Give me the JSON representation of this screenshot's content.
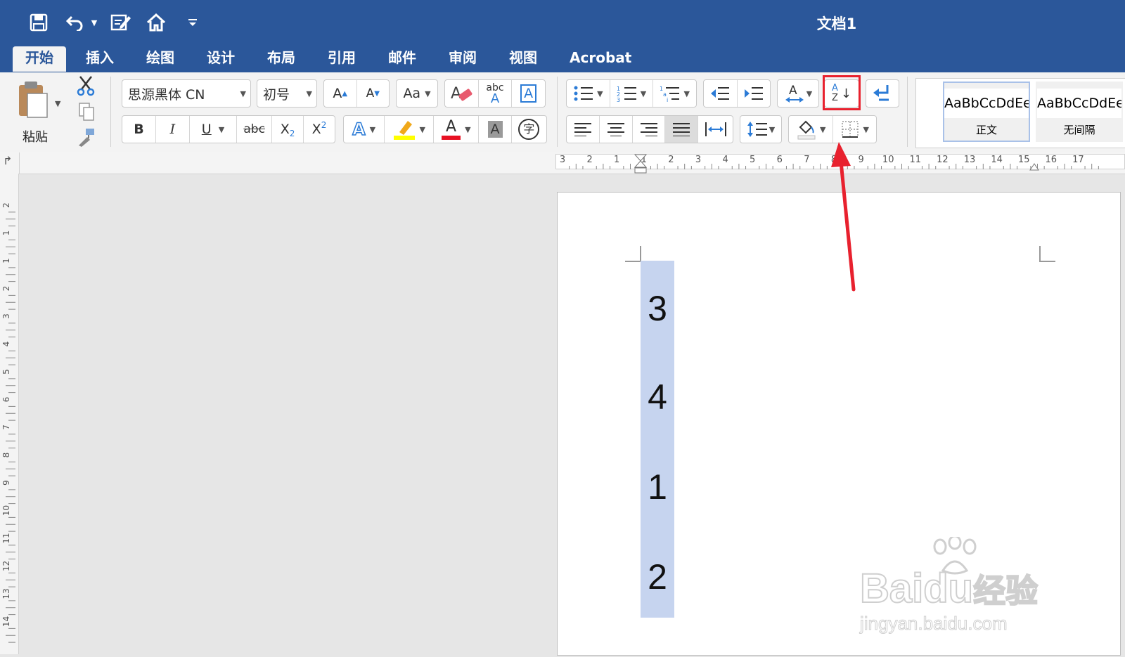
{
  "document": {
    "title": "文档1"
  },
  "quick_access": [
    "save-icon",
    "undo-icon",
    "edit-document-icon",
    "home-icon",
    "customize-icon"
  ],
  "tabs": [
    "开始",
    "插入",
    "绘图",
    "设计",
    "布局",
    "引用",
    "邮件",
    "审阅",
    "视图",
    "Acrobat"
  ],
  "ribbon": {
    "paste_label": "粘贴",
    "font_name": "思源黑体 CN",
    "font_size": "初号",
    "grow_font": "A",
    "shrink_font": "A",
    "change_case": "Aa",
    "phonetic": "abc",
    "char_border": "A",
    "bold": "B",
    "italic": "I",
    "underline": "U",
    "strike": "abc",
    "subscript": "X",
    "subscript_mark": "2",
    "superscript": "X",
    "superscript_mark": "2",
    "text_effect": "A",
    "font_color_label": "A",
    "char_shading": "A",
    "enclose_char": "字",
    "sort_top": "A",
    "sort_bottom": "Z",
    "styles": [
      {
        "preview": "AaBbCcDdEe",
        "name": "正文"
      },
      {
        "preview": "AaBbCcDdEe",
        "name": "无间隔"
      }
    ]
  },
  "colors": {
    "accent": "#2b579a",
    "highlight": "#ffff00",
    "font_color": "#e81123",
    "selection": "#c6d4ef",
    "annotation": "#e8212e"
  },
  "ruler": {
    "h_labels": [
      "3",
      "2",
      "1",
      "1",
      "2",
      "3",
      "4",
      "5",
      "6",
      "7",
      "8",
      "9",
      "10",
      "11",
      "12",
      "13",
      "14",
      "15",
      "16",
      "17"
    ],
    "v_labels": [
      "2",
      "1",
      "1",
      "2",
      "3",
      "4",
      "5",
      "6",
      "7",
      "8",
      "9",
      "10",
      "11",
      "12",
      "13",
      "14"
    ]
  },
  "document_content": {
    "lines": [
      "3",
      "4",
      "1",
      "2"
    ]
  },
  "watermark": {
    "brand": "Baidu",
    "suffix": "经验",
    "url": "jingyan.baidu.com"
  }
}
